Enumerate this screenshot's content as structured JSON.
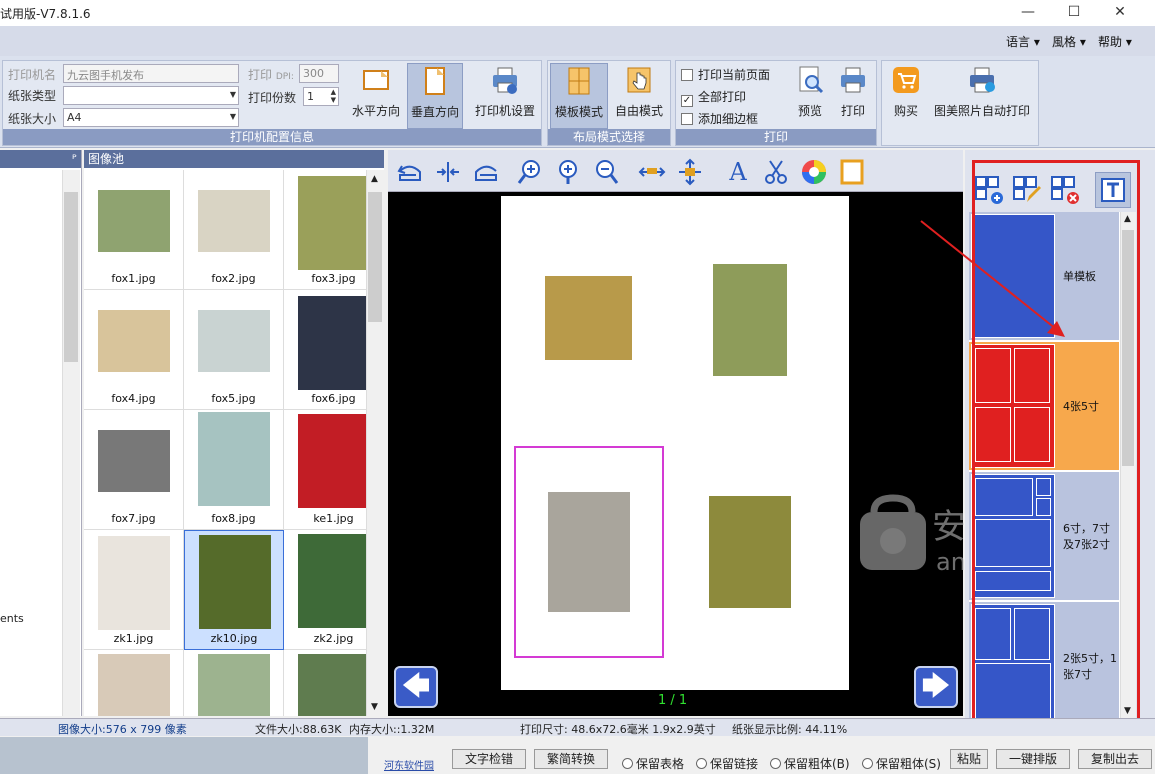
{
  "window": {
    "title": "试用版-V7.8.1.6",
    "minimize": "—",
    "maximize": "☐",
    "close": "✕"
  },
  "menu": {
    "items": [
      {
        "label": "语言 ▾"
      },
      {
        "label": "風格 ▾"
      },
      {
        "label": "帮助 ▾"
      }
    ]
  },
  "ribbon": {
    "printer_label": "打印机名",
    "printer_value": "九云图手机发布",
    "paper_type_label": "纸张类型",
    "paper_type_value": "",
    "paper_size_label": "纸张大小",
    "paper_size_value": "A4",
    "dpi_label": "打印",
    "dpi_small": "DPI:",
    "dpi_value": "300",
    "copies_label": "打印份数",
    "copies_value": "1",
    "horizontal": "水平方向",
    "vertical": "垂直方向",
    "printer_settings": "打印机设置",
    "group1": "打印机配置信息",
    "template_mode": "模板模式",
    "free_mode": "自由模式",
    "group2": "布局模式选择",
    "print_current": "打印当前页面",
    "print_all": "全部打印",
    "add_border": "添加细边框",
    "preview": "预览",
    "print": "打印",
    "group3": "打印",
    "buy": "购买",
    "auto_print": "图美照片自动打印"
  },
  "left": {
    "partial_text": "ents"
  },
  "pool": {
    "title": "图像池",
    "pin": "ᴾ",
    "items": [
      {
        "name": "fox1.jpg",
        "color": "#8fa370"
      },
      {
        "name": "fox2.jpg",
        "color": "#d9d4c4"
      },
      {
        "name": "fox3.jpg",
        "color": "#9aa05a"
      },
      {
        "name": "fox4.jpg",
        "color": "#d8c49b"
      },
      {
        "name": "fox5.jpg",
        "color": "#c9d3d2"
      },
      {
        "name": "fox6.jpg",
        "color": "#2d3447"
      },
      {
        "name": "fox7.jpg",
        "color": "#787878"
      },
      {
        "name": "fox8.jpg",
        "color": "#a6c3c1"
      },
      {
        "name": "ke1.jpg",
        "color": "#c21d25"
      },
      {
        "name": "zk1.jpg",
        "color": "#e9e4dd"
      },
      {
        "name": "zk10.jpg",
        "color": "#556b2a"
      },
      {
        "name": "zk2.jpg",
        "color": "#3e6a38"
      },
      {
        "name": "",
        "color": "#d8cab8"
      },
      {
        "name": "",
        "color": "#9db38f"
      },
      {
        "name": "",
        "color": "#5f7c4f"
      }
    ]
  },
  "editor": {
    "page_indicator": "1 / 1",
    "prev": "🡄",
    "next": "🡆",
    "text_tool": "A"
  },
  "watermark": {
    "brand": "安下载",
    "domain": "anxz.com"
  },
  "templates": {
    "items": [
      {
        "label": "单模板"
      },
      {
        "label": "4张5寸"
      },
      {
        "label": "6寸，7寸及7张2寸"
      },
      {
        "label": "2张5寸，1张7寸"
      }
    ]
  },
  "status": {
    "image_size": "图像大小:576 x 799 像素",
    "file_size": "文件大小:88.63K",
    "memory": "内存大小::1.32M",
    "print_size": "打印尺寸: 48.6x72.6毫米  1.9x2.9英寸",
    "ratio": "纸张显示比例: 44.11%"
  },
  "bottom": {
    "link": "河东软件园",
    "spell_check": "文字检错",
    "convert": "繁简转换",
    "keep_table": "保留表格",
    "keep_link": "保留链接",
    "keep_bold_b": "保留粗体(B)",
    "keep_bold_s": "保留粗体(S)",
    "paste": "粘贴",
    "one_key": "一键排版",
    "copy_out": "复制出去"
  }
}
